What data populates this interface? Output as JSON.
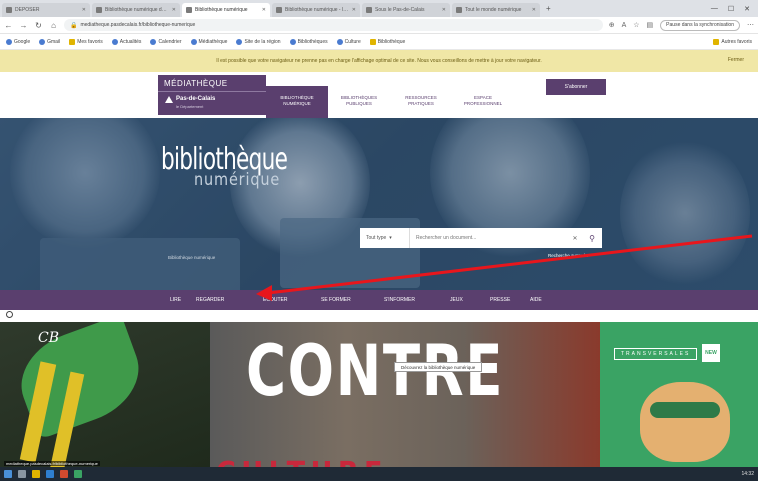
{
  "browser": {
    "tabs": [
      {
        "label": "DÉPOSER",
        "active": false
      },
      {
        "label": "Bibliothèque numérique du Pas-de-Calais",
        "active": false
      },
      {
        "label": "Bibliothèque numérique",
        "active": true
      },
      {
        "label": "Bibliothèque numérique - liste",
        "active": false
      },
      {
        "label": "Sous le Pas-de-Calais",
        "active": false
      },
      {
        "label": "Tout le monde numérique",
        "active": false
      }
    ],
    "url": "mediatheque.pasdecalais.fr/bibliotheque-numerique",
    "profile_label": "Pause dans la synchronisation",
    "bookmarks": [
      {
        "label": "Google",
        "folder": false
      },
      {
        "label": "Gmail",
        "folder": false
      },
      {
        "label": "Mes favoris",
        "folder": true
      },
      {
        "label": "Actualités",
        "folder": false
      },
      {
        "label": "Calendrier",
        "folder": false
      },
      {
        "label": "Médiathèque",
        "folder": false
      },
      {
        "label": "Site de la région",
        "folder": false
      },
      {
        "label": "Bibliothèques",
        "folder": false
      },
      {
        "label": "Culture",
        "folder": false
      },
      {
        "label": "Bibliothèque",
        "folder": true
      }
    ],
    "other_bookmarks": "Autres favoris"
  },
  "notice": {
    "text": "Il est possible que votre navigateur ne prenne pas en charge l'affichage optimal de ce site. Nous vous conseillons de mettre à jour votre navigateur.",
    "close_label": "Fermer"
  },
  "header": {
    "logo_title": "MÉDIATHÈQUE",
    "logo_org": "Pas-de-Calais",
    "logo_tagline": "le Département",
    "nav": [
      {
        "label": "BIBLIOTHÈQUE NUMÉRIQUE",
        "active": true
      },
      {
        "label": "BIBLIOTHÈQUES PUBLIQUES",
        "active": false
      },
      {
        "label": "RESSOURCES PRATIQUES",
        "active": false
      },
      {
        "label": "ESPACE PROFESSIONNEL",
        "active": false
      }
    ],
    "subscribe_label": "S'abonner"
  },
  "hero": {
    "title": "bibliothèque",
    "subtitle": "numérique",
    "search": {
      "scope": "Tout type",
      "placeholder": "Rechercher un document..."
    },
    "credits": "Bibliothèque numérique",
    "sublink": "Recherche avancée"
  },
  "menu": {
    "items": [
      {
        "label": "LIRE"
      },
      {
        "label": "REGARDER"
      },
      {
        "label": "ÉCOUTER"
      },
      {
        "label": "SE FORMER"
      },
      {
        "label": "S'INFORMER"
      },
      {
        "label": "JEUX"
      },
      {
        "label": "PRESSE"
      },
      {
        "label": "AIDE"
      }
    ]
  },
  "poster": {
    "headline": "CONTRE",
    "second_line": "CULTURE",
    "corner_text": "CB",
    "tooltip": "Découvrez la bibliothèque numérique",
    "brand": "TRANSVERSALES",
    "badge": "NEW",
    "status_hint": "mediatheque.pasdecalais.fr/bibliotheque-numerique"
  },
  "colors": {
    "brand_purple": "#5a3f6e",
    "notice_yellow": "#f0e7a6",
    "annotation_red": "#e8161c",
    "poster_green": "#3aa364"
  },
  "taskbar": {
    "clock": "14:32"
  }
}
